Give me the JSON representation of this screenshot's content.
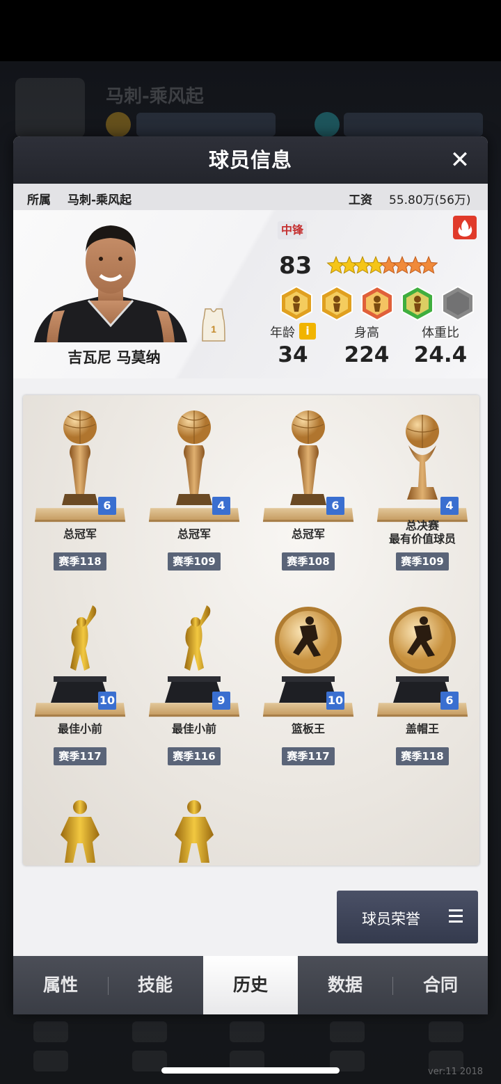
{
  "modal": {
    "title": "球员信息",
    "close_icon": "close-icon"
  },
  "info_bar": {
    "team_label": "所属",
    "team_value": "马刺-乘风起",
    "salary_label": "工资",
    "salary_value": "55.80万(56万)"
  },
  "player": {
    "name": "吉瓦尼 马莫纳",
    "jersey_number": "1",
    "position": "中锋",
    "rating": "83",
    "stars_total": 8,
    "stars_gold": 4,
    "stats": [
      {
        "label": "年龄",
        "value": "34"
      },
      {
        "label": "身高",
        "value": "224"
      },
      {
        "label": "体重比",
        "value": "24.4"
      }
    ],
    "info_icon_text": "i",
    "skills": [
      {
        "icon": "post-up-skill-icon",
        "color": "#e0a020"
      },
      {
        "icon": "speed-skill-icon",
        "color": "#e0a020"
      },
      {
        "icon": "shooting-skill-icon",
        "color": "#e0603a"
      },
      {
        "icon": "rebound-skill-icon",
        "color": "#3fae3f"
      },
      {
        "icon": "locked-skill-icon",
        "color": "#888888"
      }
    ]
  },
  "trophies": [
    {
      "name": "总冠军",
      "season": "赛季118",
      "count": "6",
      "kind": "cup"
    },
    {
      "name": "总冠军",
      "season": "赛季109",
      "count": "4",
      "kind": "cup"
    },
    {
      "name": "总冠军",
      "season": "赛季108",
      "count": "6",
      "kind": "cup"
    },
    {
      "name": "总决赛\n最有价值球员",
      "season": "赛季109",
      "count": "4",
      "kind": "fmvp"
    },
    {
      "name": "最佳小前",
      "season": "赛季117",
      "count": "10",
      "kind": "dunk"
    },
    {
      "name": "最佳小前",
      "season": "赛季116",
      "count": "9",
      "kind": "dunk"
    },
    {
      "name": "篮板王",
      "season": "赛季117",
      "count": "10",
      "kind": "medal"
    },
    {
      "name": "盖帽王",
      "season": "赛季118",
      "count": "6",
      "kind": "medal"
    },
    {
      "name": "",
      "season": "",
      "count": "",
      "kind": "figure"
    },
    {
      "name": "",
      "season": "",
      "count": "",
      "kind": "figure"
    }
  ],
  "honor_button": {
    "label": "球员荣誉"
  },
  "tabs": [
    {
      "label": "属性",
      "active": false
    },
    {
      "label": "技能",
      "active": false
    },
    {
      "label": "历史",
      "active": true
    },
    {
      "label": "数据",
      "active": false
    },
    {
      "label": "合同",
      "active": false
    }
  ],
  "background": {
    "team_name": "马刺-乘风起",
    "version": "ver:11  2018"
  }
}
